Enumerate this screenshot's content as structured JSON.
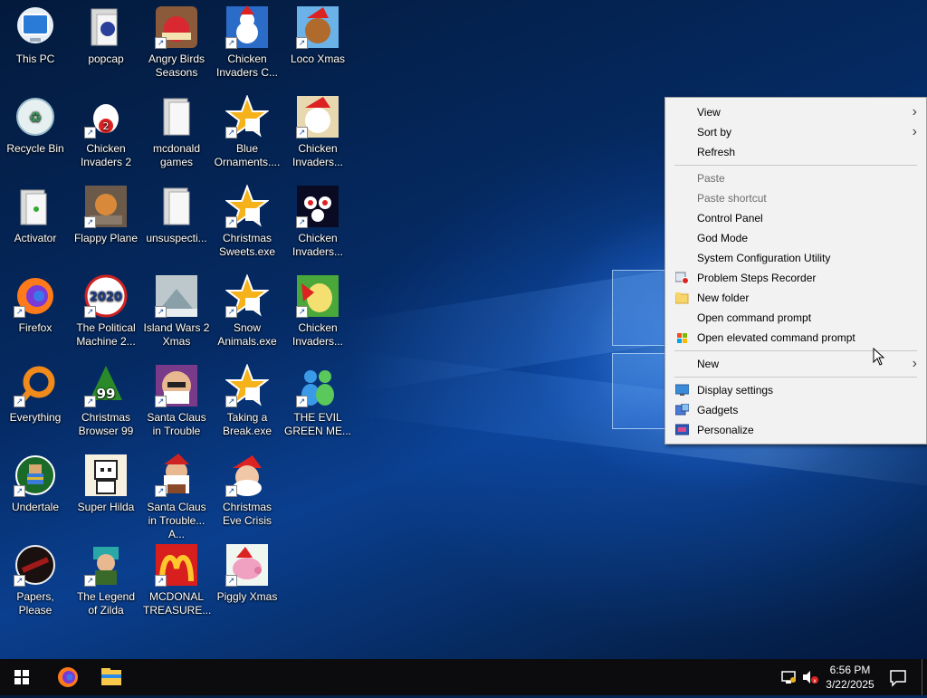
{
  "desktop": {
    "icons": [
      {
        "label": "This PC"
      },
      {
        "label": "popcap"
      },
      {
        "label": "Angry Birds Seasons"
      },
      {
        "label": "Chicken Invaders C..."
      },
      {
        "label": "Loco Xmas"
      },
      {
        "label": "Recycle Bin"
      },
      {
        "label": "Chicken Invaders 2"
      },
      {
        "label": "mcdonald games"
      },
      {
        "label": "Blue Ornaments...."
      },
      {
        "label": "Chicken Invaders..."
      },
      {
        "label": "Activator"
      },
      {
        "label": "Flappy Plane"
      },
      {
        "label": "unsuspecti..."
      },
      {
        "label": "Christmas Sweets.exe"
      },
      {
        "label": "Chicken Invaders..."
      },
      {
        "label": "Firefox"
      },
      {
        "label": "The Political Machine 2..."
      },
      {
        "label": "Island Wars 2 Xmas"
      },
      {
        "label": "Snow Animals.exe"
      },
      {
        "label": "Chicken Invaders..."
      },
      {
        "label": "Everything"
      },
      {
        "label": "Christmas Browser 99"
      },
      {
        "label": "Santa Claus in Trouble"
      },
      {
        "label": "Taking a Break.exe"
      },
      {
        "label": "THE EVIL GREEN ME..."
      },
      {
        "label": "Undertale"
      },
      {
        "label": "Super Hilda"
      },
      {
        "label": "Santa Claus in Trouble... A..."
      },
      {
        "label": "Christmas Eve Crisis"
      },
      {
        "label": "Papers, Please"
      },
      {
        "label": "The Legend of Zilda"
      },
      {
        "label": "MCDONAL TREASURE..."
      },
      {
        "label": "Piggly Xmas"
      }
    ]
  },
  "context_menu": {
    "view": "View",
    "sort_by": "Sort by",
    "refresh": "Refresh",
    "paste": "Paste",
    "paste_shortcut": "Paste shortcut",
    "control_panel": "Control Panel",
    "god_mode": "God Mode",
    "system_configuration": "System Configuration Utility",
    "problem_steps_recorder": "Problem Steps Recorder",
    "new_folder": "New folder",
    "open_command_prompt": "Open command prompt",
    "open_elevated_command_prompt": "Open elevated command prompt",
    "new": "New",
    "display_settings": "Display settings",
    "gadgets": "Gadgets",
    "personalize": "Personalize"
  },
  "taskbar": {
    "time": "6:56 PM",
    "date": "3/22/2025"
  },
  "colors": {
    "menu_bg": "#f2f2f2",
    "taskbar_bg": "#0c0c0f",
    "desktop_blue": "#0a3f8f"
  }
}
